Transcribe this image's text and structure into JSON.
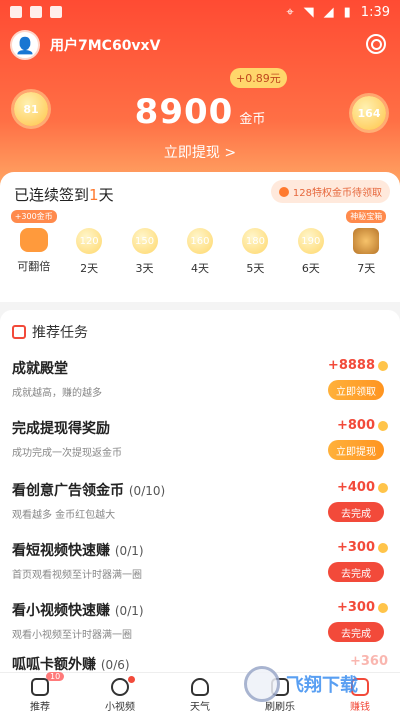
{
  "statusbar": {
    "time": "1:39"
  },
  "user": {
    "name": "用户7MC60vxV"
  },
  "bonus": "+0.89元",
  "coins": {
    "amount": "8900",
    "unit": "金币",
    "withdraw": "立即提现 >"
  },
  "bubbles": {
    "left": "81",
    "right": "164"
  },
  "signin": {
    "title_prefix": "已连续签到",
    "days_count": "1",
    "title_suffix": "天",
    "privilege": "128特权金币待领取",
    "days": [
      {
        "coin": "",
        "label": "可翻倍",
        "tag": "+300金币"
      },
      {
        "coin": "120",
        "label": "2天"
      },
      {
        "coin": "150",
        "label": "3天"
      },
      {
        "coin": "160",
        "label": "4天"
      },
      {
        "coin": "180",
        "label": "5天"
      },
      {
        "coin": "190",
        "label": "6天"
      },
      {
        "coin": "",
        "label": "7天",
        "tag": "神秘宝箱"
      }
    ]
  },
  "tasks": {
    "header": "推荐任务",
    "items": [
      {
        "title": "成就殿堂",
        "count": "",
        "desc": "成就越高，赚的越多",
        "reward": "+8888",
        "button": "立即领取",
        "style": "gold"
      },
      {
        "title": "完成提现得奖励",
        "count": "",
        "desc": "成功完成一次提现返金币",
        "reward": "+800",
        "button": "立即提现",
        "style": "gold"
      },
      {
        "title": "看创意广告领金币",
        "count": "(0/10)",
        "desc": "观看越多 金币红包越大",
        "reward": "+400",
        "button": "去完成",
        "style": "red"
      },
      {
        "title": "看短视频快速赚",
        "count": "(0/1)",
        "desc": "首页观看视频至计时器满一圈",
        "reward": "+300",
        "button": "去完成",
        "style": "red"
      },
      {
        "title": "看小视频快速赚",
        "count": "(0/1)",
        "desc": "观看小视频至计时器满一圈",
        "reward": "+300",
        "button": "去完成",
        "style": "red"
      },
      {
        "title": "呱呱卡额外赚",
        "count": "(0/6)",
        "desc": "",
        "reward": "+360",
        "button": "",
        "style": "red"
      }
    ]
  },
  "nav": [
    {
      "label": "推荐",
      "badge": "10"
    },
    {
      "label": "小视频"
    },
    {
      "label": "天气"
    },
    {
      "label": "刷刷乐"
    },
    {
      "label": "赚钱"
    }
  ],
  "watermark": {
    "text": "飞翔下载"
  }
}
